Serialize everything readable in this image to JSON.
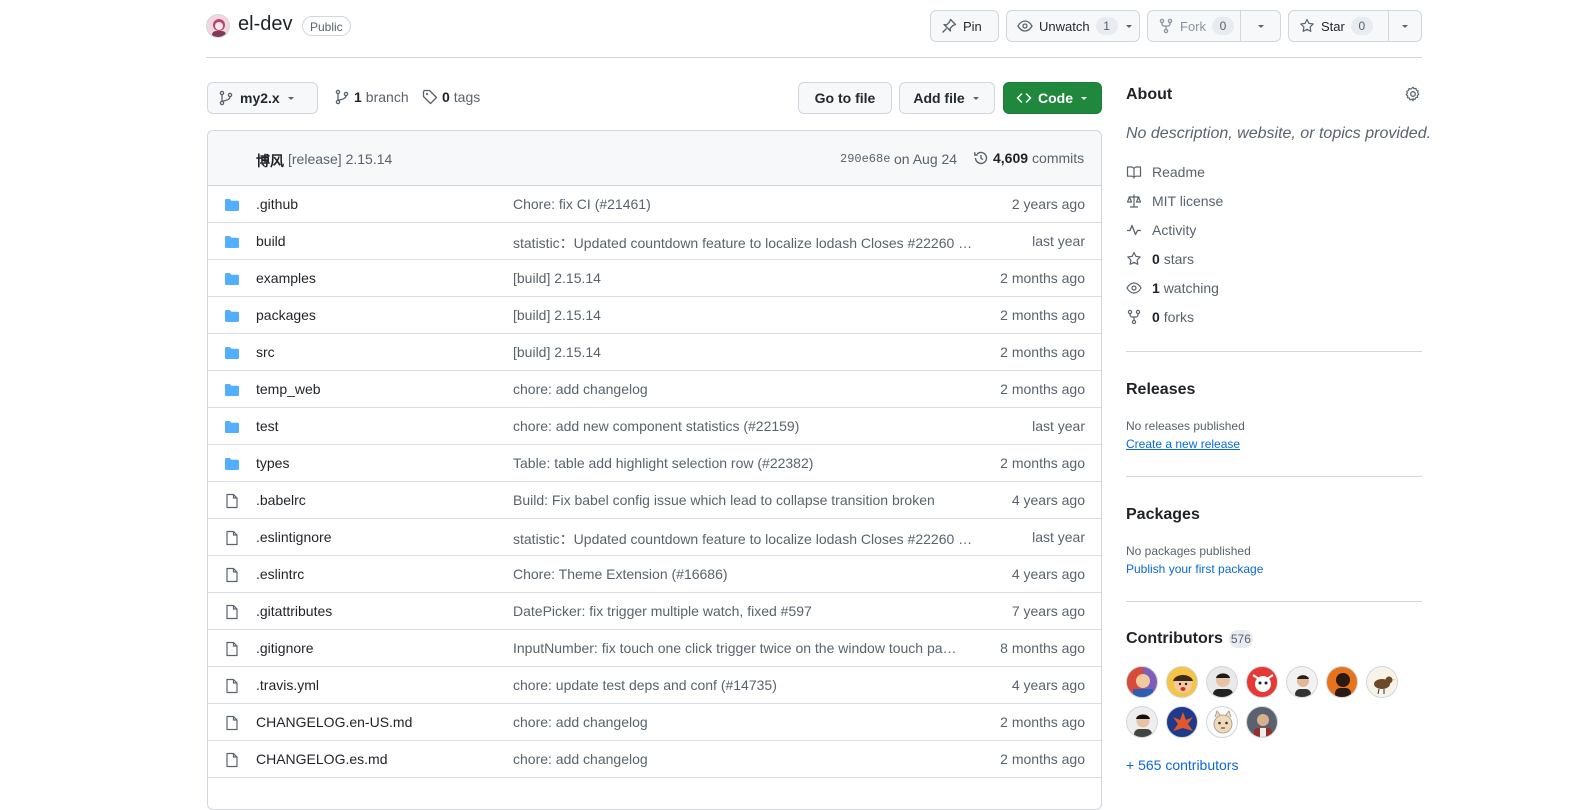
{
  "repo": {
    "name": "el-dev",
    "visibility": "Public"
  },
  "header_actions": {
    "pin_label": "Pin",
    "unwatch_label": "Unwatch",
    "unwatch_count": "1",
    "fork_label": "Fork",
    "fork_count": "0",
    "star_label": "Star",
    "star_count": "0"
  },
  "toolbar": {
    "branch": "my2.x",
    "branch_count": "1",
    "branch_word": "branch",
    "tag_count": "0",
    "tag_word": "tags",
    "go_to_file": "Go to file",
    "add_file": "Add file",
    "code": "Code"
  },
  "latest_commit": {
    "author": "博风",
    "message": "[release] 2.15.14",
    "sha": "290e68e",
    "date": "on Aug 24",
    "commit_count": "4,609",
    "commit_word": "commits"
  },
  "files": [
    {
      "type": "dir",
      "name": ".github",
      "message": "Chore: fix CI (#21461)",
      "date": "2 years ago"
    },
    {
      "type": "dir",
      "name": "build",
      "message": "statistic：Updated countdown feature to localize lodash Closes #22260 …",
      "date": "last year"
    },
    {
      "type": "dir",
      "name": "examples",
      "message": "[build] 2.15.14",
      "date": "2 months ago"
    },
    {
      "type": "dir",
      "name": "packages",
      "message": "[build] 2.15.14",
      "date": "2 months ago"
    },
    {
      "type": "dir",
      "name": "src",
      "message": "[build] 2.15.14",
      "date": "2 months ago"
    },
    {
      "type": "dir",
      "name": "temp_web",
      "message": "chore: add changelog",
      "date": "2 months ago"
    },
    {
      "type": "dir",
      "name": "test",
      "message": "chore: add new component statistics (#22159)",
      "date": "last year"
    },
    {
      "type": "dir",
      "name": "types",
      "message": "Table: table add highlight selection row (#22382)",
      "date": "2 months ago"
    },
    {
      "type": "file",
      "name": ".babelrc",
      "message": "Build: Fix babel config issue which lead to collapse transition broken",
      "date": "4 years ago"
    },
    {
      "type": "file",
      "name": ".eslintignore",
      "message": "statistic：Updated countdown feature to localize lodash Closes #22260 …",
      "date": "last year"
    },
    {
      "type": "file",
      "name": ".eslintrc",
      "message": "Chore: Theme Extension (#16686)",
      "date": "4 years ago"
    },
    {
      "type": "file",
      "name": ".gitattributes",
      "message": "DatePicker: fix trigger multiple watch, fixed #597",
      "date": "7 years ago"
    },
    {
      "type": "file",
      "name": ".gitignore",
      "message": "InputNumber: fix touch one click trigger twice on the window touch pa…",
      "date": "8 months ago"
    },
    {
      "type": "file",
      "name": ".travis.yml",
      "message": "chore: update test deps and conf (#14735)",
      "date": "4 years ago"
    },
    {
      "type": "file",
      "name": "CHANGELOG.en-US.md",
      "message": "chore: add changelog",
      "date": "2 months ago"
    },
    {
      "type": "file",
      "name": "CHANGELOG.es.md",
      "message": "chore: add changelog",
      "date": "2 months ago"
    }
  ],
  "about": {
    "title": "About",
    "description": "No description, website, or topics provided.",
    "readme": "Readme",
    "license": "MIT license",
    "activity": "Activity",
    "stars_count": "0",
    "stars_word": "stars",
    "watching_count": "1",
    "watching_word": "watching",
    "forks_count": "0",
    "forks_word": "forks"
  },
  "releases": {
    "title": "Releases",
    "empty": "No releases published",
    "link": "Create a new release"
  },
  "packages": {
    "title": "Packages",
    "empty": "No packages published",
    "link": "Publish your first package"
  },
  "contributors": {
    "title": "Contributors",
    "count": "576",
    "more": "+ 565 contributors"
  },
  "colors": {
    "code_button": "#1f883d",
    "folder": "#54aeff",
    "link": "#0969da"
  }
}
